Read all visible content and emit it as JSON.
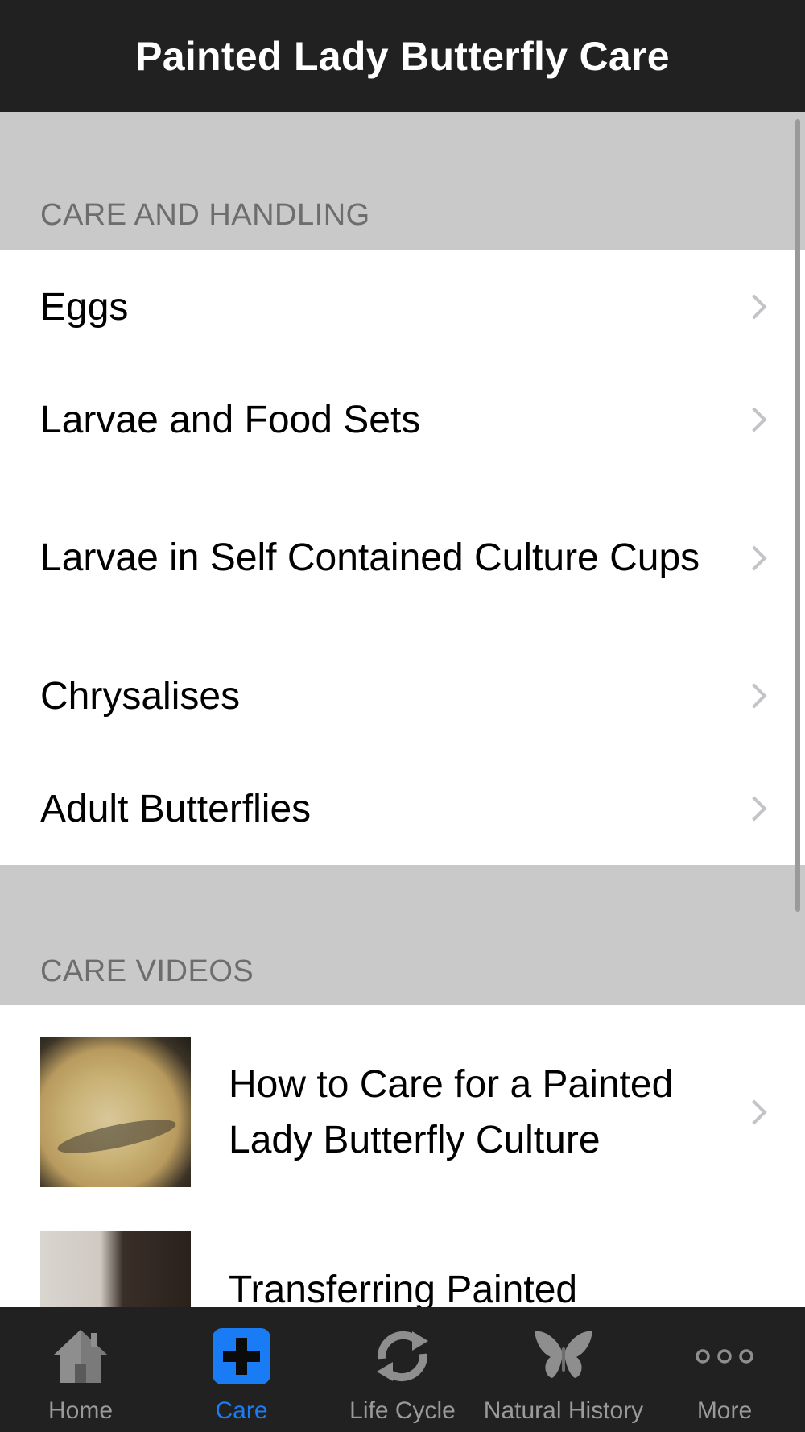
{
  "header": {
    "title": "Painted Lady Butterfly Care"
  },
  "sections": [
    {
      "title": "CARE AND HANDLING",
      "items": [
        {
          "label": "Eggs"
        },
        {
          "label": "Larvae and Food Sets"
        },
        {
          "label": "Larvae in Self Contained Culture Cups"
        },
        {
          "label": "Chrysalises"
        },
        {
          "label": "Adult Butterflies"
        }
      ]
    },
    {
      "title": "CARE VIDEOS",
      "items": [
        {
          "label": "How to Care for a Painted Lady Butterfly Culture"
        },
        {
          "label": "Transferring Painted"
        }
      ]
    }
  ],
  "tabbar": {
    "tabs": [
      {
        "label": "Home",
        "icon": "home-icon"
      },
      {
        "label": "Care",
        "icon": "plus-icon",
        "active": true
      },
      {
        "label": "Life Cycle",
        "icon": "cycle-icon"
      },
      {
        "label": "Natural History",
        "icon": "butterfly-icon"
      },
      {
        "label": "More",
        "icon": "more-icon"
      }
    ]
  },
  "colors": {
    "navbar": "#212121",
    "section_bg": "#c9c9c9",
    "section_text": "#6d6d6d",
    "accent": "#1a7cf5",
    "tab_inactive": "#9a9a9a"
  }
}
